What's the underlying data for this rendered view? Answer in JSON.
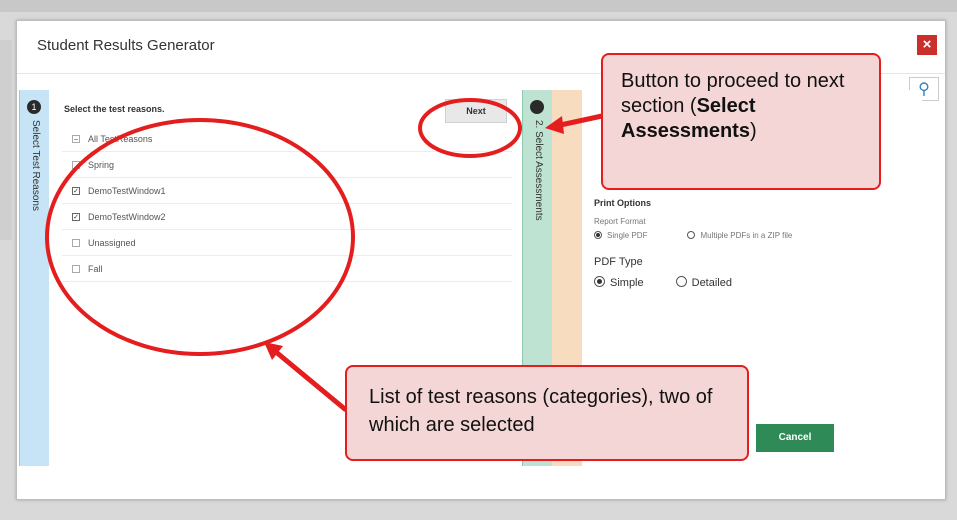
{
  "modal": {
    "title": "Student Results Generator",
    "close_icon": "×"
  },
  "steps": [
    {
      "number": "1",
      "label": "Select Test Reasons"
    },
    {
      "number": "2",
      "label": "2. Select Assessments"
    }
  ],
  "test_reasons": {
    "prompt": "Select the test reasons.",
    "next_label": "Next",
    "items": [
      {
        "label": "All TestReasons",
        "checked": false,
        "partial": true
      },
      {
        "label": "Spring",
        "checked": false
      },
      {
        "label": "DemoTestWindow1",
        "checked": true
      },
      {
        "label": "DemoTestWindow2",
        "checked": true
      },
      {
        "label": "Unassigned",
        "checked": false
      },
      {
        "label": "Fall",
        "checked": false
      }
    ]
  },
  "print_options": {
    "header": "Print Options",
    "report_format_label": "Report Format",
    "format_options": [
      "Single PDF",
      "Multiple PDFs in a ZIP file"
    ],
    "format_selected": "Single PDF",
    "pdf_type_label": "PDF Type",
    "pdf_type_options": [
      "Simple",
      "Detailed"
    ],
    "pdf_type_selected": "Simple",
    "cancel_label": "Cancel"
  },
  "callouts": {
    "next_button_text_pre": "Button to proceed to next section (",
    "next_button_text_bold": "Select Assessments",
    "next_button_text_post": ")",
    "reasons_text": "List of test reasons (categories), two of which are selected"
  },
  "colors": {
    "annotation_red": "#e41e1e",
    "callout_fill": "#f5d6d6",
    "cancel_green": "#2e8b57",
    "close_red": "#c9302c",
    "step1_blue": "#c6e4f5",
    "step2_green": "#bfe3d2"
  }
}
